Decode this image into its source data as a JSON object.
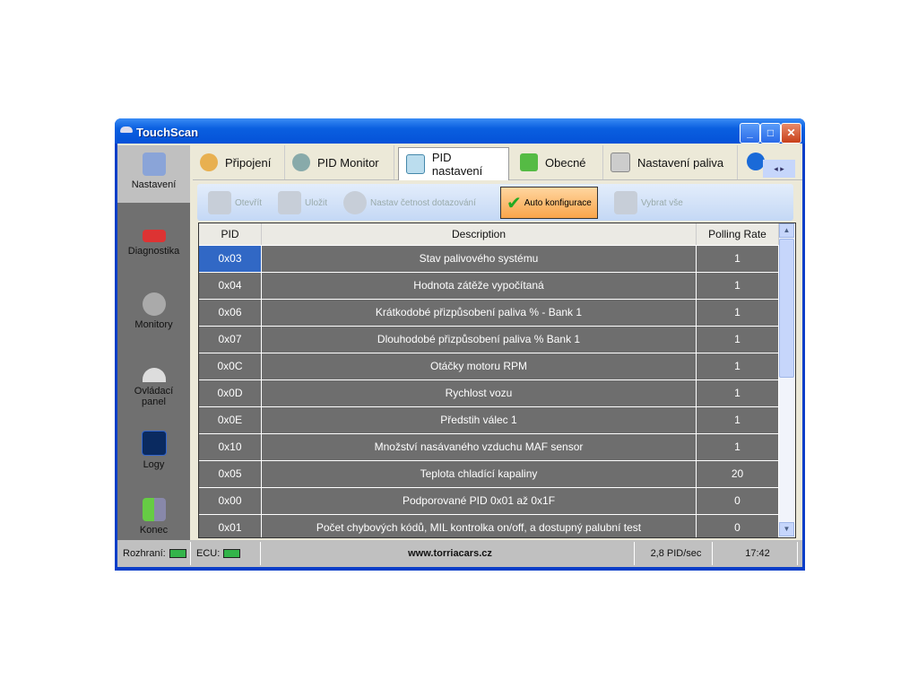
{
  "window": {
    "title": "TouchScan",
    "minimize": "_",
    "maximize": "□",
    "close": "✕"
  },
  "sidebar": {
    "items": [
      {
        "label": "Nastavení",
        "icon": "checklist-icon"
      },
      {
        "label": "Diagnostika",
        "icon": "car-icon"
      },
      {
        "label": "Monitory",
        "icon": "magnifier-icon"
      },
      {
        "label": "Ovládací panel",
        "icon": "gauge-icon"
      },
      {
        "label": "Logy",
        "icon": "waveform-icon"
      },
      {
        "label": "Konec",
        "icon": "exit-door-icon"
      }
    ]
  },
  "tabs": [
    {
      "label": "Připojení",
      "icon": "connect-icon"
    },
    {
      "label": "PID Monitor",
      "icon": "pid-monitor-icon"
    },
    {
      "label": "PID nastavení",
      "icon": "pid-settings-icon"
    },
    {
      "label": "Obecné",
      "icon": "check-icon"
    },
    {
      "label": "Nastavení paliva",
      "icon": "fuel-settings-icon"
    }
  ],
  "toolbar": {
    "open": "Otevřít",
    "save": "Uložit",
    "set_rate": "Nastav četnost dotazování",
    "auto": "Auto konfigurace",
    "select_all": "Vybrat vše"
  },
  "table": {
    "headers": [
      "PID",
      "Description",
      "Polling Rate"
    ],
    "rows": [
      [
        "0x03",
        "Stav palivového systému",
        "1"
      ],
      [
        "0x04",
        "Hodnota zátěže vypočítaná",
        "1"
      ],
      [
        "0x06",
        "Krátkodobé přizpůsobení paliva % - Bank 1",
        "1"
      ],
      [
        "0x07",
        "Dlouhodobé přizpůsobení paliva % Bank 1",
        "1"
      ],
      [
        "0x0C",
        "Otáčky motoru RPM",
        "1"
      ],
      [
        "0x0D",
        "Rychlost vozu",
        "1"
      ],
      [
        "0x0E",
        "Předstih válec 1",
        "1"
      ],
      [
        "0x10",
        "Množství nasávaného vzduchu MAF sensor",
        "1"
      ],
      [
        "0x05",
        "Teplota chladící kapaliny",
        "20"
      ],
      [
        "0x00",
        "Podporované PID 0x01 až 0x1F",
        "0"
      ],
      [
        "0x01",
        "Počet chybových kódů, MIL kontrolka on/off, a dostupný palubní test",
        "0"
      ]
    ]
  },
  "status": {
    "interface": "Rozhraní:",
    "ecu": "ECU:",
    "website": "www.torriacars.cz",
    "rate": "2,8 PID/sec",
    "time": "17:42",
    "led_color": "#33b44a"
  }
}
